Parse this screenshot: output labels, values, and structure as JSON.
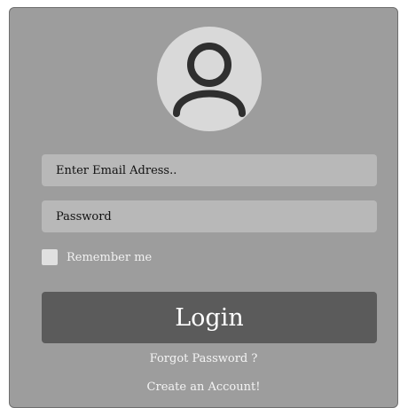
{
  "avatar": {
    "icon": "user-icon"
  },
  "form": {
    "email_placeholder": "Enter Email Adress..",
    "password_placeholder": "Password",
    "remember_label": "Remember me",
    "login_label": "Login",
    "forgot_label": "Forgot Password ?",
    "create_label": "Create an Account!"
  },
  "colors": {
    "card_background": "#9d9d9d",
    "field_background": "#b8b8b8",
    "button_background": "#5b5b5b",
    "avatar_background": "#d9d9d9"
  }
}
